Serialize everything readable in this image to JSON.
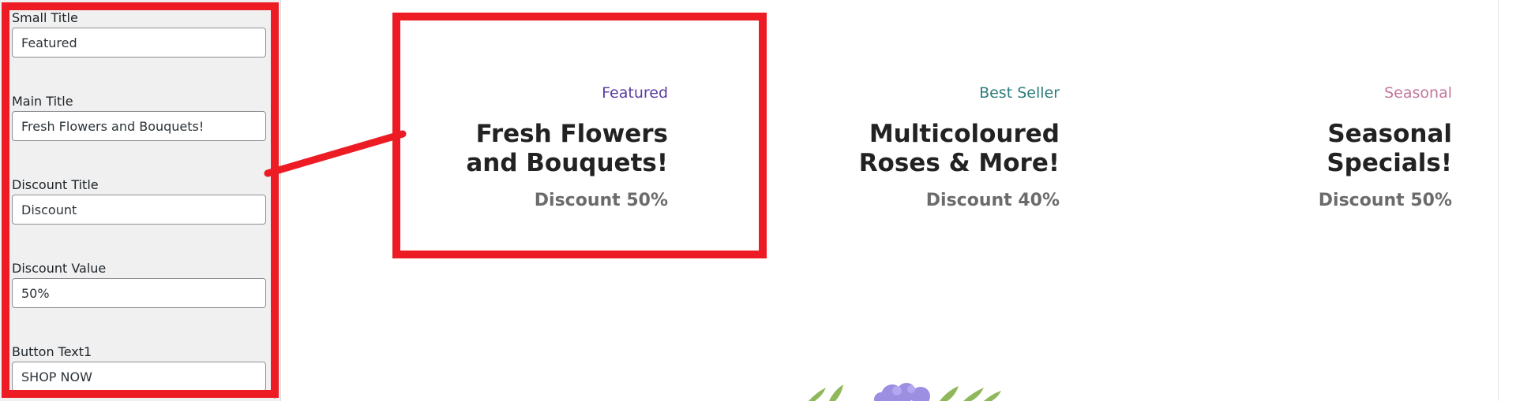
{
  "settings_panel": {
    "fields": [
      {
        "label": "Small Title",
        "value": "Featured"
      },
      {
        "label": "Main Title",
        "value": "Fresh Flowers and Bouquets!"
      },
      {
        "label": "Discount Title",
        "value": "Discount"
      },
      {
        "label": "Discount Value",
        "value": "50%"
      },
      {
        "label": "Button Text1",
        "value": "SHOP NOW"
      }
    ]
  },
  "banners": [
    {
      "small_title": "Featured",
      "small_title_color": "#5b3fa0",
      "title_line1": "Fresh Flowers",
      "title_line2": "and Bouquets!",
      "discount": "Discount 50%"
    },
    {
      "small_title": "Best Seller",
      "small_title_color": "#2e7d7a",
      "title_line1": "Multicoloured",
      "title_line2": "Roses & More!",
      "discount": "Discount 40%"
    },
    {
      "small_title": "Seasonal",
      "small_title_color": "#c2789c",
      "title_line1": "Seasonal",
      "title_line2": "Specials!",
      "discount": "Discount 50%"
    }
  ],
  "colors": {
    "highlight": "#ed1c24",
    "panel_bg": "#f0f0f1",
    "title_text": "#222222",
    "discount_text": "#6b6b6b"
  }
}
